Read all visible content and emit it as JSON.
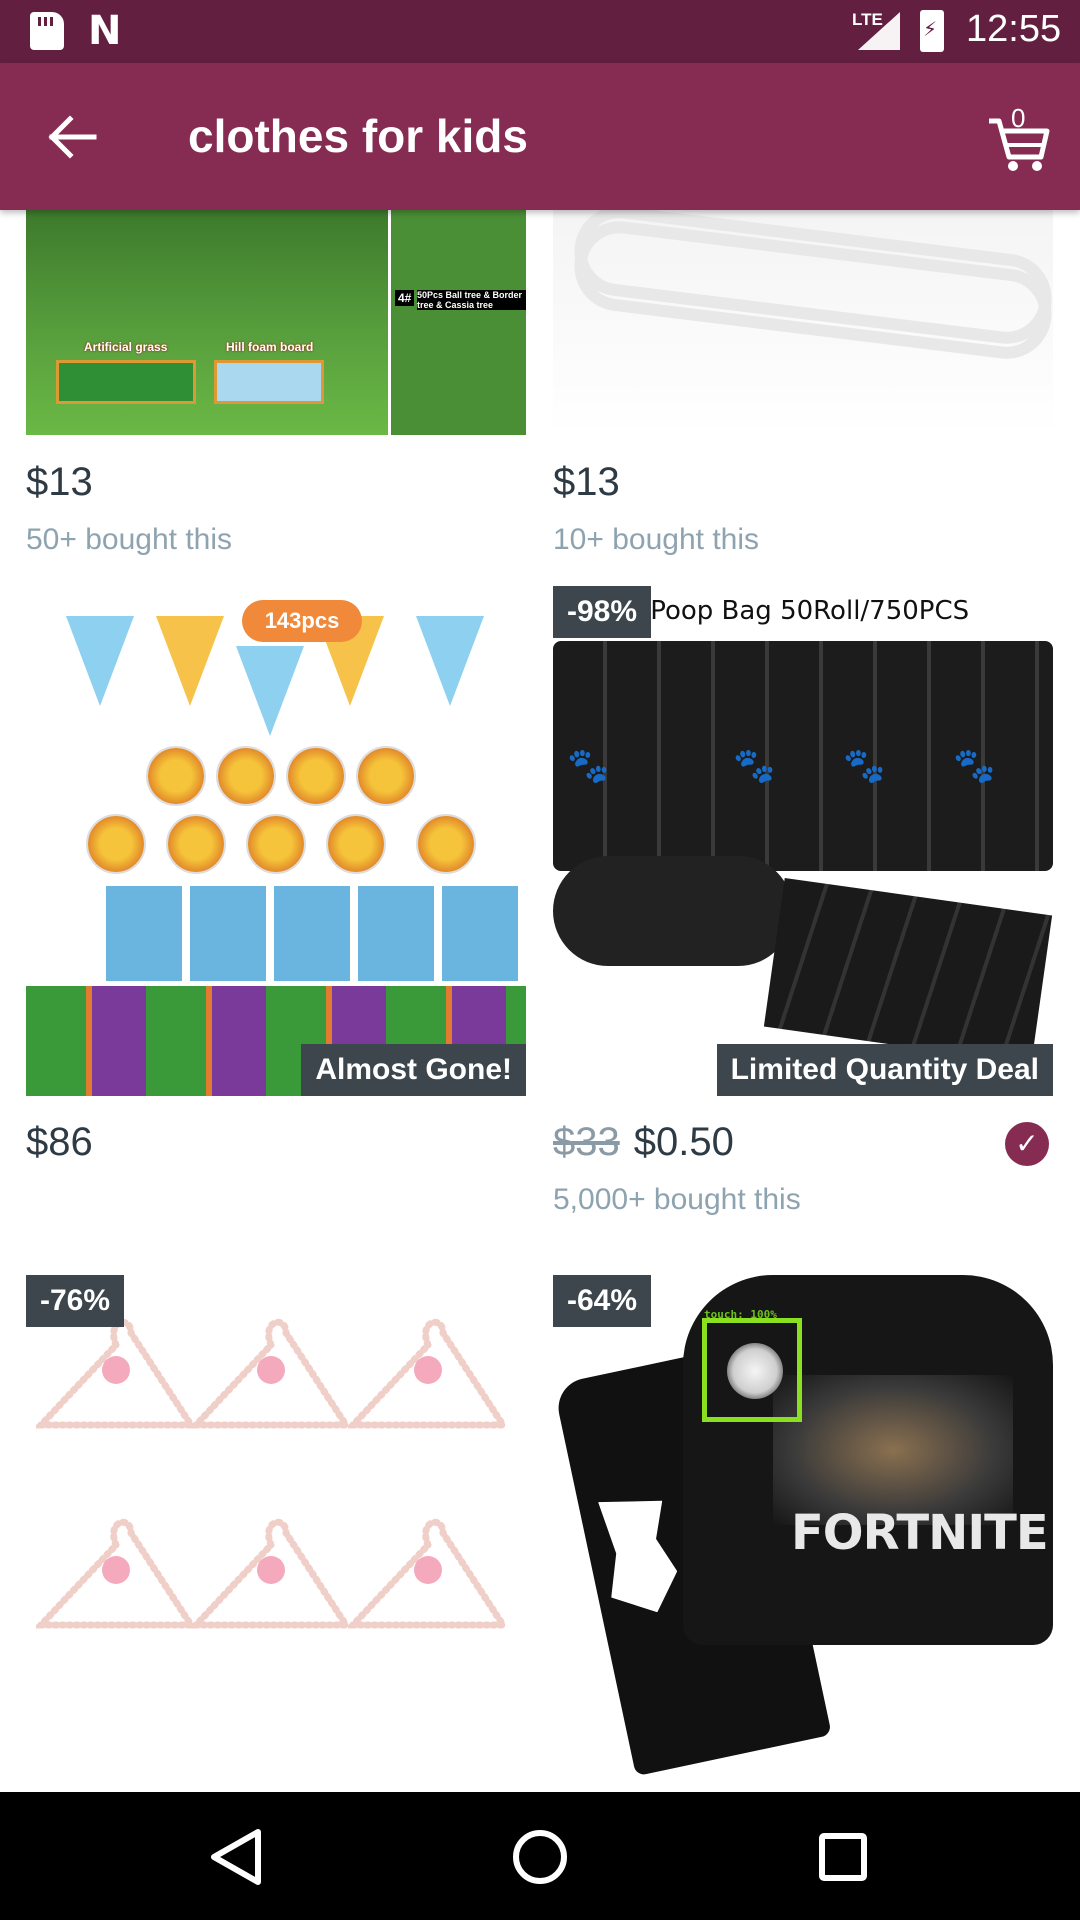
{
  "status_bar": {
    "network": "LTE",
    "time": "12:55",
    "icons": [
      "sd-card-icon",
      "n-notification-icon",
      "signal-icon",
      "battery-charging-icon"
    ]
  },
  "app_bar": {
    "title": "clothes for kids",
    "cart_count": "0",
    "icons": [
      "back-arrow-icon",
      "cart-icon"
    ]
  },
  "products": [
    {
      "price": "$13",
      "bought": "50+ bought this",
      "image": "miniature-trees",
      "image_text": [
        "Artificial grass",
        "Hill foam board",
        "4#",
        "50Pcs Ball tree & Border tree & Cassia tree"
      ]
    },
    {
      "price": "$13",
      "bought": "10+ bought this",
      "image": "white-hangers"
    },
    {
      "price": "$86",
      "bought": "",
      "deal_badge": "Almost Gone!",
      "image": "winnie-the-pooh-party-set",
      "image_text": [
        "143pcs"
      ]
    },
    {
      "old_price": "$33",
      "price": "$0.50",
      "bought": "5,000+ bought this",
      "discount": "-98%",
      "deal_badge": "Limited Quantity Deal",
      "verified": true,
      "image": "pet-poop-bags",
      "image_text": [
        "Pet Poop Bag 50Roll/750PCS"
      ]
    },
    {
      "discount": "-76%",
      "image": "pink-pearl-hangers"
    },
    {
      "discount": "-64%",
      "image": "fortnite-hoodie-set",
      "image_text": [
        "FORTNITE"
      ]
    }
  ],
  "touch_overlay": {
    "label": "touch: 100%"
  },
  "colors": {
    "status_bar": "#631f3f",
    "app_bar": "#862b52",
    "price": "#2e3b45",
    "bought": "#8ea3b0",
    "badge": "#3c464c",
    "touch_box": "#8ae01e"
  }
}
